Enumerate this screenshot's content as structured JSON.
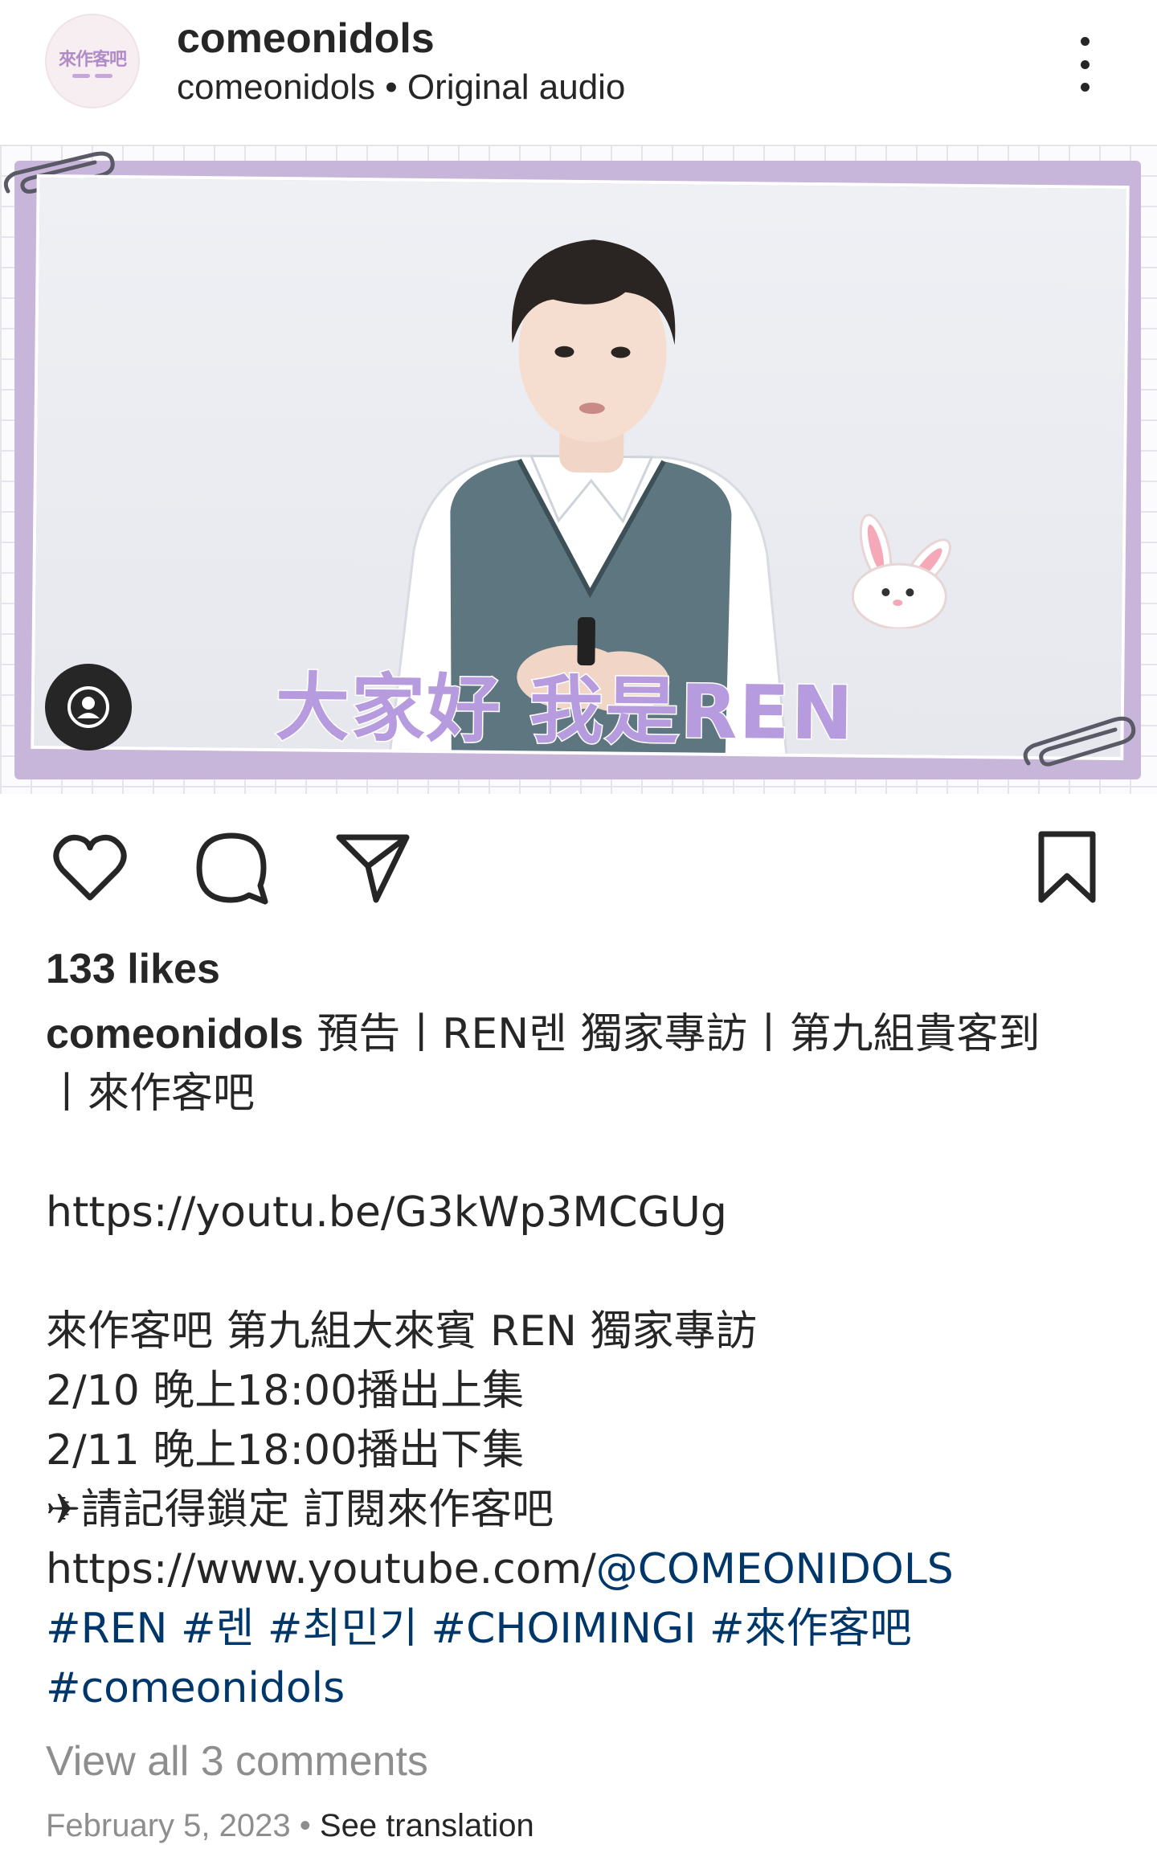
{
  "header": {
    "avatar_text": "來作客吧",
    "account_name": "comeonidols",
    "sub_account": "comeonidols",
    "separator": "•",
    "audio_label": "Original audio"
  },
  "media": {
    "subtitle": "大家好 我是REN"
  },
  "likes": "133 likes",
  "caption": {
    "username": "comeonidols",
    "title_line1": "預告丨REN렌 獨家專訪丨第九組貴客到",
    "title_line2": "丨來作客吧",
    "link1": "https://youtu.be/G3kWp3MCGUg",
    "line_intro": "來作客吧 第九組大來賓 REN 獨家專訪",
    "line_date1": "2/10 晚上18:00播出上集",
    "line_date2": "2/11 晚上18:00播出下集",
    "line_subscribe": "✈請記得鎖定 訂閱來作客吧",
    "link2_prefix": "https://www.youtube.com/",
    "link2_mention": "@COMEONIDOLS",
    "hashtags_line1": "#REN #렌 #최민기 #CHOIMINGI #來作客吧",
    "hashtags_line2": "#comeonidols"
  },
  "view_comments": "View all 3 comments",
  "date": "February 5, 2023",
  "meta_sep": "•",
  "see_translation": "See translation",
  "colors": {
    "text": "#262626",
    "muted": "#8e8e8e",
    "link": "#00376b",
    "frame": "#c7b6d9"
  },
  "icons": [
    "more-icon",
    "user-tag-icon",
    "heart-icon",
    "comment-icon",
    "share-icon",
    "bookmark-icon"
  ]
}
